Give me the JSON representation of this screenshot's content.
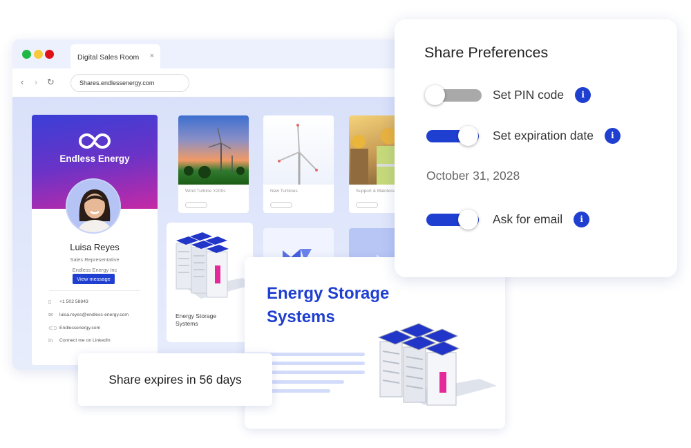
{
  "browser": {
    "tab_title": "Digital Sales Room",
    "tab_close_icon": "×",
    "url": "Shares.endlessenergy.com",
    "nav": {
      "back": "‹",
      "forward": "›",
      "reload": "↻"
    }
  },
  "profile": {
    "brand_name": "Endless Energy",
    "name": "Luisa Reyes",
    "title": "Sales Representative",
    "company": "Endless Energy Inc",
    "view_message_label": "View message",
    "contacts": [
      {
        "icon": "phone-icon",
        "glyph": "▯",
        "text": "+1 502 58843"
      },
      {
        "icon": "mail-icon",
        "glyph": "✉",
        "text": "luisa.reyes@endless-energy.com"
      },
      {
        "icon": "link-icon",
        "glyph": "⊂⊃",
        "text": "Endlessenergy.com"
      },
      {
        "icon": "linkedin-icon",
        "glyph": "in",
        "text": "Connect me on LinkedIn"
      }
    ]
  },
  "tiles": [
    {
      "caption": "Wind Turbine X200s"
    },
    {
      "caption": "New Turbines"
    },
    {
      "caption": "Support & Maintenance"
    }
  ],
  "storage_tile": {
    "caption": "Energy Storage Systems"
  },
  "feature_card": {
    "title_line1": "Energy Storage",
    "title_line2": "Systems"
  },
  "toast": {
    "text": "Share expires in 56 days"
  },
  "share_preferences": {
    "title": "Share Preferences",
    "options": [
      {
        "label": "Set PIN code",
        "enabled": false,
        "info": "i"
      },
      {
        "label": "Set expiration date",
        "enabled": true,
        "info": "i"
      },
      {
        "label": "Ask for email",
        "enabled": true,
        "info": "i"
      }
    ],
    "expiration_date": "October 31, 2028"
  },
  "colors": {
    "accent": "#1f3fd0",
    "toggle_off": "#a9a9a9",
    "gradient_start": "#3a3fd6",
    "gradient_end": "#c629a5",
    "battery_pink": "#e42a9a"
  }
}
